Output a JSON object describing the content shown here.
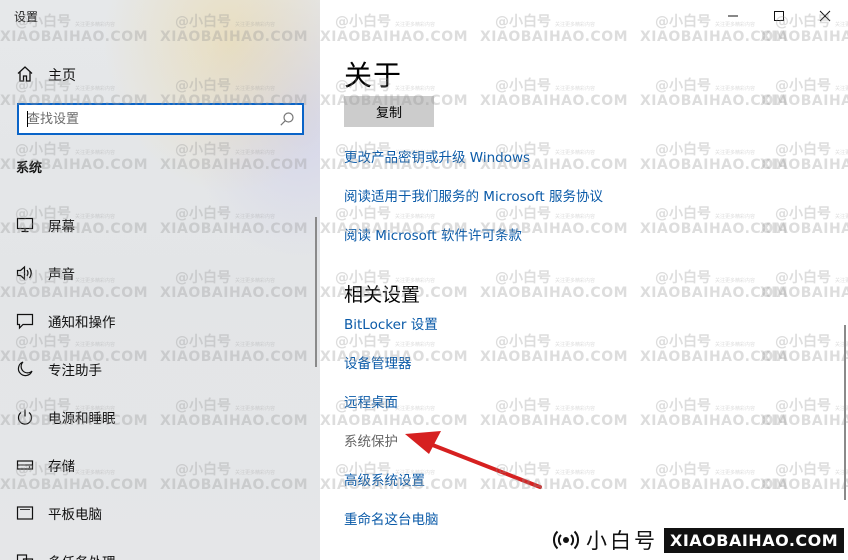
{
  "window": {
    "title": "设置"
  },
  "sidebar": {
    "home_label": "主页",
    "search_placeholder": "查找设置",
    "section_title": "系统",
    "items": [
      {
        "label": "屏幕",
        "icon": "monitor-icon"
      },
      {
        "label": "声音",
        "icon": "speaker-icon"
      },
      {
        "label": "通知和操作",
        "icon": "message-icon"
      },
      {
        "label": "专注助手",
        "icon": "moon-icon"
      },
      {
        "label": "电源和睡眠",
        "icon": "power-icon"
      },
      {
        "label": "存储",
        "icon": "storage-icon"
      },
      {
        "label": "平板电脑",
        "icon": "tablet-icon"
      },
      {
        "label": "多任务处理",
        "icon": "multitask-icon"
      }
    ]
  },
  "main": {
    "title": "关于",
    "copy_button": "复制",
    "links": [
      "更改产品密钥或升级 Windows",
      "阅读适用于我们服务的 Microsoft 服务协议",
      "阅读 Microsoft 软件许可条款"
    ],
    "related_title": "相关设置",
    "related_links": [
      "BitLocker 设置",
      "设备管理器",
      "远程桌面",
      "系统保护",
      "高级系统设置",
      "重命名这台电脑"
    ]
  },
  "watermark": {
    "cn": "@小白号",
    "small": "关注更多精彩内容",
    "en": "XIAOBAIHAO.COM"
  },
  "brand": {
    "cn": "小白号",
    "en": "XIAOBAIHAO.COM"
  },
  "colors": {
    "accent": "#0a64c8",
    "link": "#0a5aa8",
    "annotation_arrow": "#d62020"
  }
}
